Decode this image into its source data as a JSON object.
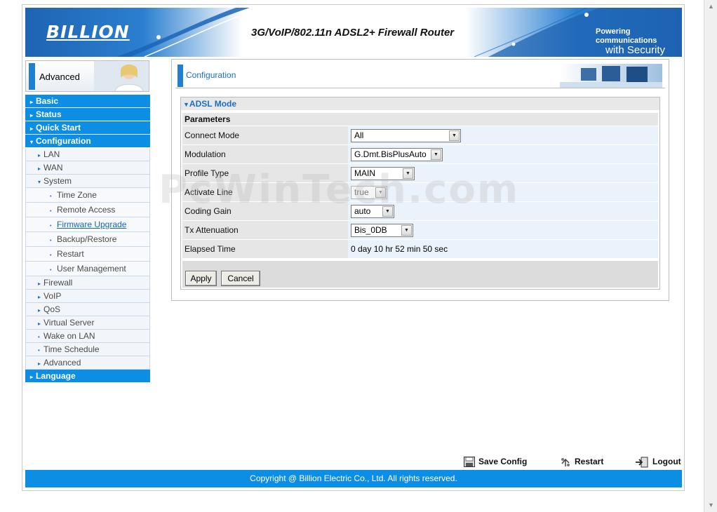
{
  "header": {
    "logo": "BILLION",
    "product_title": "3G/VoIP/802.11n ADSL2+ Firewall Router",
    "tagline_line1": "Powering communications",
    "tagline_line2": "with Security"
  },
  "sidebar": {
    "mode_label": "Advanced",
    "items": [
      {
        "label": "Basic",
        "level": "top"
      },
      {
        "label": "Status",
        "level": "top"
      },
      {
        "label": "Quick Start",
        "level": "top"
      },
      {
        "label": "Configuration",
        "level": "top",
        "expanded": true
      },
      {
        "label": "LAN",
        "level": "sub"
      },
      {
        "label": "WAN",
        "level": "sub"
      },
      {
        "label": "System",
        "level": "sub",
        "expanded": true
      },
      {
        "label": "Time Zone",
        "level": "sub2"
      },
      {
        "label": "Remote Access",
        "level": "sub2"
      },
      {
        "label": "Firmware Upgrade",
        "level": "sub2",
        "active": true
      },
      {
        "label": "Backup/Restore",
        "level": "sub2"
      },
      {
        "label": "Restart",
        "level": "sub2"
      },
      {
        "label": "User Management",
        "level": "sub2"
      },
      {
        "label": "Firewall",
        "level": "sub"
      },
      {
        "label": "VoIP",
        "level": "sub"
      },
      {
        "label": "QoS",
        "level": "sub"
      },
      {
        "label": "Virtual Server",
        "level": "sub"
      },
      {
        "label": "Wake on LAN",
        "level": "sub"
      },
      {
        "label": "Time Schedule",
        "level": "sub"
      },
      {
        "label": "Advanced",
        "level": "sub"
      },
      {
        "label": "Language",
        "level": "top"
      }
    ]
  },
  "main": {
    "page_title": "Configuration",
    "section_title": "ADSL Mode",
    "params_header": "Parameters",
    "params": {
      "connect_mode": {
        "label": "Connect Mode",
        "value": "All"
      },
      "modulation": {
        "label": "Modulation",
        "value": "G.Dmt.BisPlusAuto"
      },
      "profile_type": {
        "label": "Profile Type",
        "value": "MAIN"
      },
      "activate_line": {
        "label": "Activate Line",
        "value": "true"
      },
      "coding_gain": {
        "label": "Coding Gain",
        "value": "auto"
      },
      "tx_attenuation": {
        "label": "Tx Attenuation",
        "value": "Bis_0DB"
      },
      "elapsed_time": {
        "label": "Elapsed Time",
        "value": "0 day 10 hr 52 min 50 sec"
      }
    },
    "apply_label": "Apply",
    "cancel_label": "Cancel"
  },
  "footer": {
    "save_config": "Save Config",
    "restart": "Restart",
    "logout": "Logout",
    "copyright": "Copyright @ Billion Electric Co., Ltd. All rights reserved."
  },
  "watermark": "PcWinTech.com",
  "colors": {
    "brand_blue": "#0b8ee3",
    "link_blue": "#1a6fc4",
    "label_bg": "#e6e6e6",
    "value_bg": "#eaf3fb"
  },
  "icons": [
    "save-icon",
    "restart-icon",
    "logout-icon",
    "arrow-right-icon",
    "arrow-down-icon",
    "dropdown-icon"
  ]
}
